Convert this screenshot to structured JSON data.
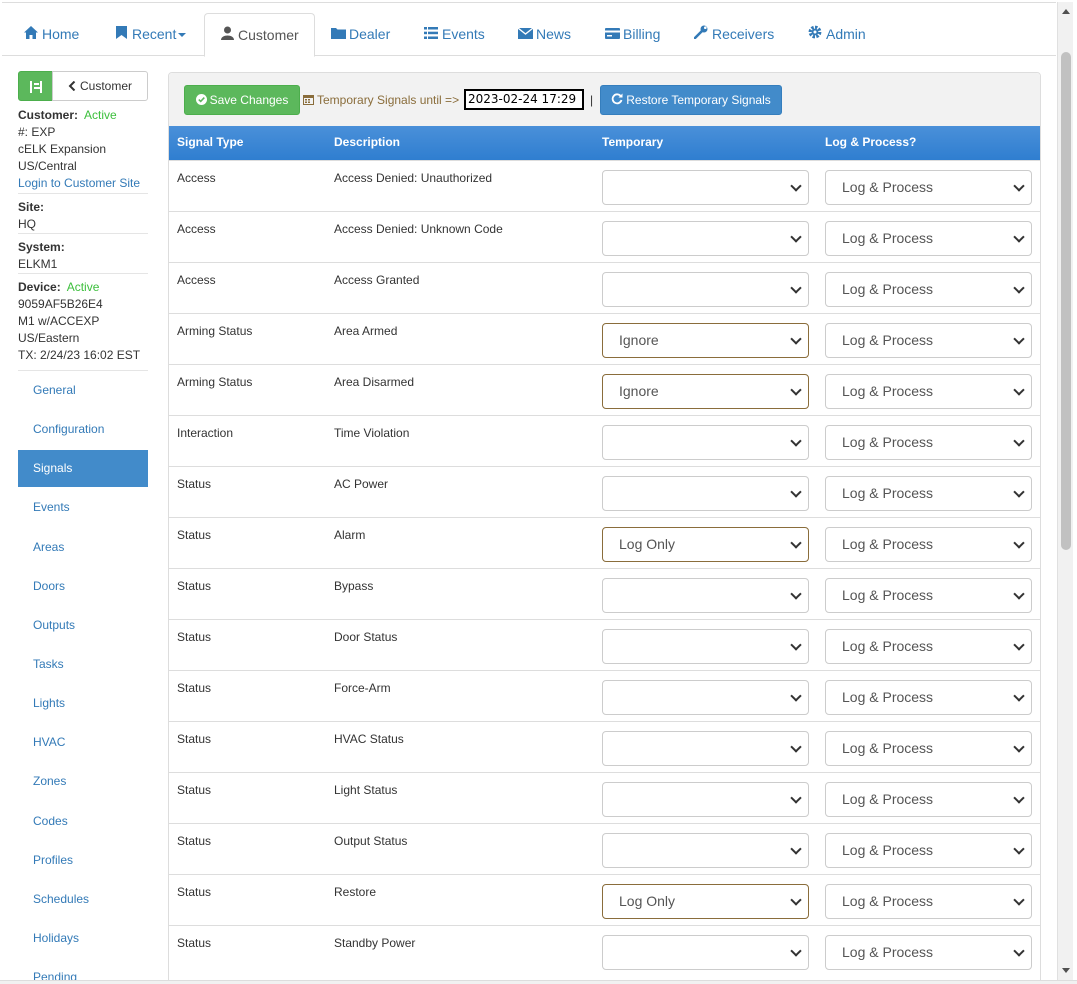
{
  "nav": {
    "tabs": [
      {
        "label": "Home",
        "icon": "home-icon"
      },
      {
        "label": "Recent",
        "icon": "bookmark-icon"
      },
      {
        "label": "Customer",
        "icon": "user-icon"
      },
      {
        "label": "Dealer",
        "icon": "folder-icon"
      },
      {
        "label": "Events",
        "icon": "list-icon"
      },
      {
        "label": "News",
        "icon": "envelope-icon"
      },
      {
        "label": "Billing",
        "icon": "credit-card-icon"
      },
      {
        "label": "Receivers",
        "icon": "wrench-icon"
      },
      {
        "label": "Admin",
        "icon": "gear-icon"
      }
    ],
    "active_tab": "Customer"
  },
  "sidebar": {
    "back_label": "Customer",
    "customer_label": "Customer:",
    "customer_status": "Active",
    "customer_number": "#: EXP",
    "customer_name": "cELK Expansion",
    "customer_tz": "US/Central",
    "login_link": "Login to Customer Site",
    "site_label": "Site:",
    "site_value": "HQ",
    "system_label": "System:",
    "system_value": "ELKM1",
    "device_label": "Device:",
    "device_status": "Active",
    "device_id": "9059AF5B26E4",
    "device_model": "M1 w/ACCEXP",
    "device_tz": "US/Eastern",
    "device_tx": "TX: 2/24/23 16:02 EST",
    "items": [
      "General",
      "Configuration",
      "Signals",
      "Events",
      "Areas",
      "Doors",
      "Outputs",
      "Tasks",
      "Lights",
      "HVAC",
      "Zones",
      "Codes",
      "Profiles",
      "Schedules",
      "Holidays",
      "Pending"
    ],
    "active_item": "Signals"
  },
  "toolbar": {
    "save_label": "Save Changes",
    "temp_label": "Temporary Signals until =>",
    "temp_value": "2023-02-24 17:29",
    "pipe": "|",
    "restore_label": "Restore Temporary Signals"
  },
  "table": {
    "headers": [
      "Signal Type",
      "Description",
      "Temporary",
      "Log & Process?"
    ],
    "rows": [
      {
        "type": "Access",
        "description": "Access Denied: Unauthorized",
        "temporary": "",
        "log": "Log & Process"
      },
      {
        "type": "Access",
        "description": "Access Denied: Unknown Code",
        "temporary": "",
        "log": "Log & Process"
      },
      {
        "type": "Access",
        "description": "Access Granted",
        "temporary": "",
        "log": "Log & Process"
      },
      {
        "type": "Arming Status",
        "description": "Area Armed",
        "temporary": "Ignore",
        "log": "Log & Process"
      },
      {
        "type": "Arming Status",
        "description": "Area Disarmed",
        "temporary": "Ignore",
        "log": "Log & Process"
      },
      {
        "type": "Interaction",
        "description": "Time Violation",
        "temporary": "",
        "log": "Log & Process"
      },
      {
        "type": "Status",
        "description": "AC Power",
        "temporary": "",
        "log": "Log & Process"
      },
      {
        "type": "Status",
        "description": "Alarm",
        "temporary": "Log Only",
        "log": "Log & Process"
      },
      {
        "type": "Status",
        "description": "Bypass",
        "temporary": "",
        "log": "Log & Process"
      },
      {
        "type": "Status",
        "description": "Door Status",
        "temporary": "",
        "log": "Log & Process"
      },
      {
        "type": "Status",
        "description": "Force-Arm",
        "temporary": "",
        "log": "Log & Process"
      },
      {
        "type": "Status",
        "description": "HVAC Status",
        "temporary": "",
        "log": "Log & Process"
      },
      {
        "type": "Status",
        "description": "Light Status",
        "temporary": "",
        "log": "Log & Process"
      },
      {
        "type": "Status",
        "description": "Output Status",
        "temporary": "",
        "log": "Log & Process"
      },
      {
        "type": "Status",
        "description": "Restore",
        "temporary": "Log Only",
        "log": "Log & Process"
      },
      {
        "type": "Status",
        "description": "Standby Power",
        "temporary": "",
        "log": "Log & Process"
      }
    ]
  },
  "colors": {
    "link": "#337ab7",
    "success": "#5cb85c",
    "primary": "#428bca",
    "warning_text": "#8a6d3b",
    "active_status": "#3cbf3c"
  }
}
